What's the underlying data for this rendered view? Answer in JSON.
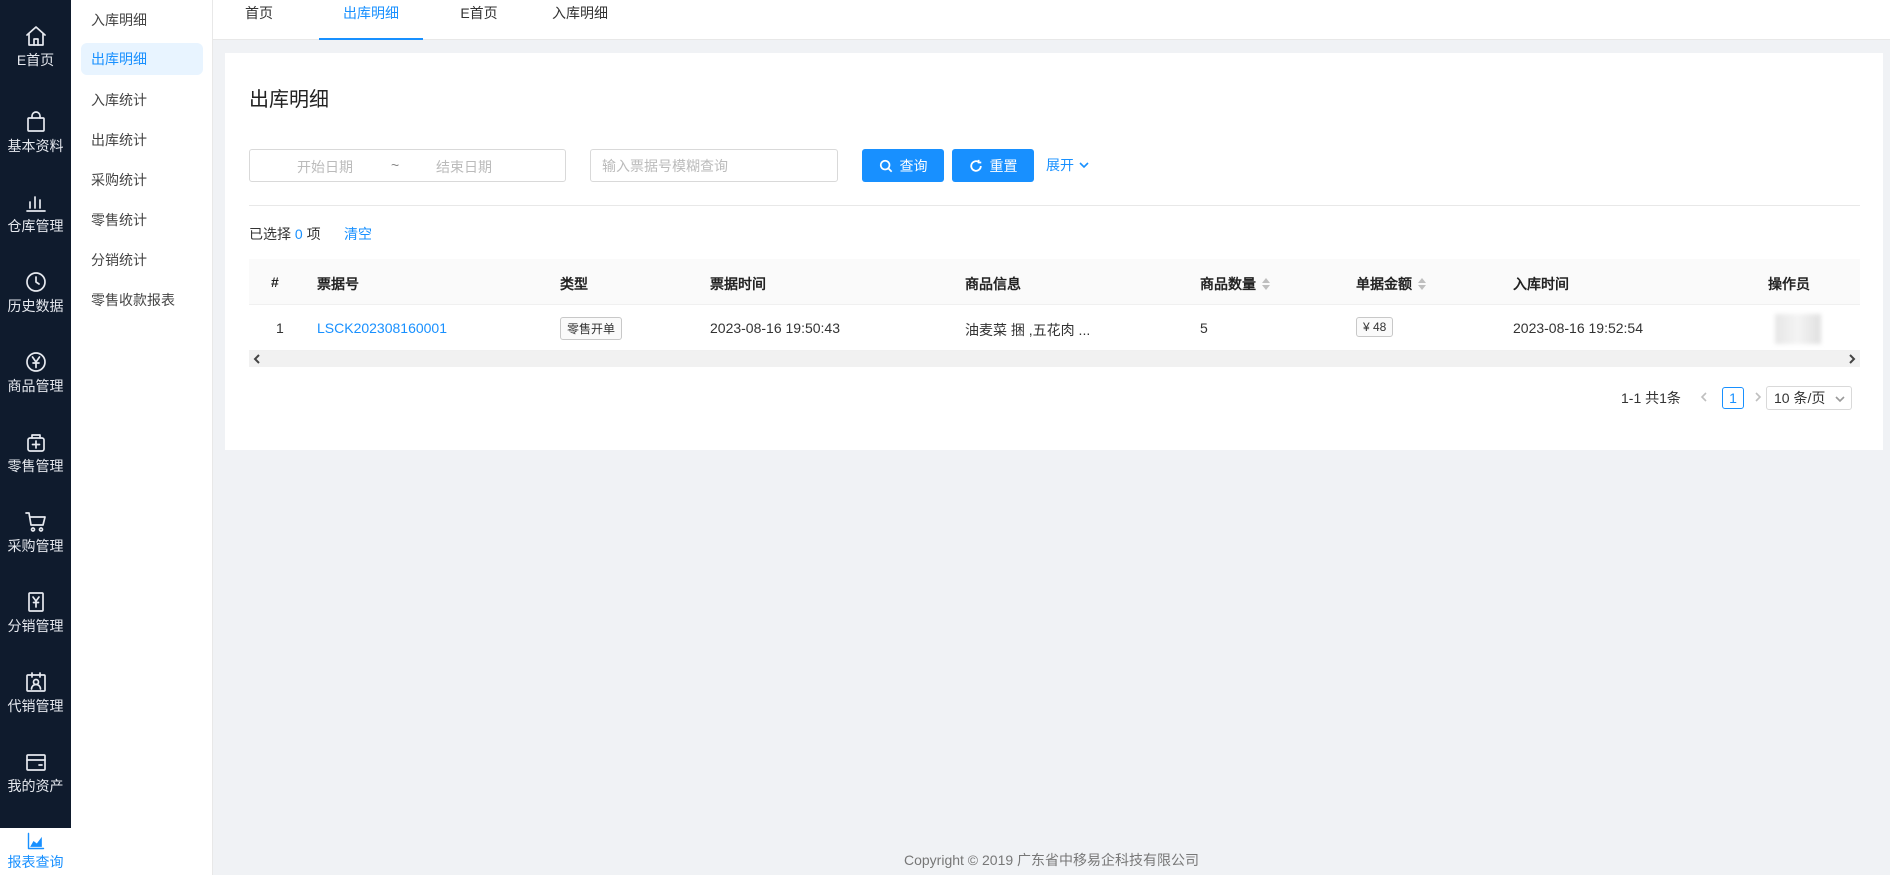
{
  "rail": {
    "items": [
      {
        "label": "E首页",
        "icon": "home-icon"
      },
      {
        "label": "基本资料",
        "icon": "bag-icon"
      },
      {
        "label": "仓库管理",
        "icon": "bar-chart-icon"
      },
      {
        "label": "历史数据",
        "icon": "clock-icon"
      },
      {
        "label": "商品管理",
        "icon": "yen-circle-icon"
      },
      {
        "label": "零售管理",
        "icon": "store-icon"
      },
      {
        "label": "采购管理",
        "icon": "cart-icon"
      },
      {
        "label": "分销管理",
        "icon": "yen-doc-icon"
      },
      {
        "label": "代销管理",
        "icon": "user-card-icon"
      },
      {
        "label": "我的资产",
        "icon": "wallet-icon"
      },
      {
        "label": "报表查询",
        "icon": "area-chart-icon"
      }
    ]
  },
  "submenu": {
    "items": [
      "入库明细",
      "出库明细",
      "入库统计",
      "出库统计",
      "采购统计",
      "零售统计",
      "分销统计",
      "零售收款报表"
    ]
  },
  "tabs": [
    "首页",
    "出库明细",
    "E首页",
    "入库明细"
  ],
  "page": {
    "title": "出库明细",
    "start_date_placeholder": "开始日期",
    "range_separator": "~",
    "end_date_placeholder": "结束日期",
    "search_placeholder": "输入票据号模糊查询",
    "query_label": "查询",
    "reset_label": "重置",
    "expand_label": "展开",
    "selected_prefix": "已选择",
    "selected_count": "0",
    "selected_suffix": "项",
    "clear_label": "清空"
  },
  "table": {
    "headers": [
      "#",
      "票据号",
      "类型",
      "票据时间",
      "商品信息",
      "商品数量",
      "单据金额",
      "入库时间",
      "操作员"
    ],
    "rows": [
      {
        "index": "1",
        "bill_no": "LSCK202308160001",
        "type": "零售开单",
        "bill_time": "2023-08-16 19:50:43",
        "goods": "油麦菜 捆 ,五花肉 ...",
        "qty": "5",
        "amount": "¥ 48",
        "in_time": "2023-08-16 19:52:54"
      }
    ]
  },
  "pagination": {
    "total_text": "1-1 共1条",
    "current_page": "1",
    "page_size": "10 条/页"
  },
  "footer": {
    "copyright": "Copyright © 2019 广东省中移易企科技有限公司"
  },
  "colors": {
    "primary": "#1890ff",
    "rail_bg": "#0f1b2d",
    "page_bg": "#f0f2f5"
  }
}
